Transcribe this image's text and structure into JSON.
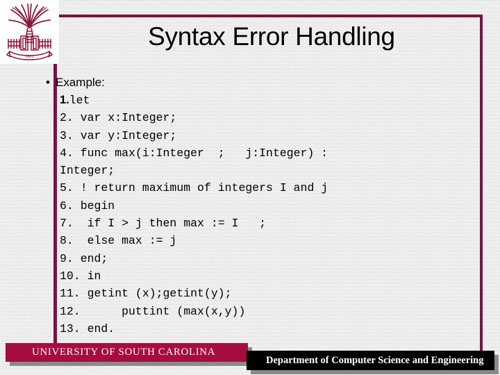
{
  "slide": {
    "title": "Syntax Error Handling",
    "bullet": {
      "marker": "•",
      "label": "Example:"
    },
    "code_lines": [
      {
        "number": "1.",
        "number_style": "sans-bold",
        "text": "let"
      },
      {
        "number": "",
        "number_style": "mono",
        "text": "2. var x:Integer;"
      },
      {
        "number": "",
        "number_style": "mono",
        "text": "3. var y:Integer;"
      },
      {
        "number": "",
        "number_style": "mono",
        "text": "4. func max(i:Integer  ;   j:Integer) :"
      },
      {
        "number": "",
        "number_style": "mono",
        "text": "Integer;"
      },
      {
        "number": "",
        "number_style": "mono",
        "text": "5. ! return maximum of integers I and j"
      },
      {
        "number": "",
        "number_style": "mono",
        "text": "6. begin"
      },
      {
        "number": "",
        "number_style": "mono",
        "text": "7.  if I > j then max := I   ;"
      },
      {
        "number": "",
        "number_style": "mono",
        "text": "8.  else max := j"
      },
      {
        "number": "",
        "number_style": "mono",
        "text": "9. end;"
      },
      {
        "number": "",
        "number_style": "mono",
        "text": "10. in"
      },
      {
        "number": "",
        "number_style": "mono",
        "text": "11. getint (x);getint(y);"
      },
      {
        "number": "",
        "number_style": "mono",
        "text": "12.      puttint (max(x,y))"
      },
      {
        "number": "",
        "number_style": "mono",
        "text": "13. end."
      }
    ]
  },
  "logo": {
    "name": "usc-palmetto-logo",
    "banner_text": "1801"
  },
  "footer": {
    "university": "UNIVERSITY OF SOUTH CAROLINA",
    "department": "Department of Computer Science and Engineering"
  },
  "colors": {
    "frame_maroon": "#7B1141",
    "footer_maroon": "#A50D3F",
    "footer_black": "#000000",
    "logo_maroon": "#8E1437",
    "background": "#E9E9E9",
    "text": "#000000"
  }
}
